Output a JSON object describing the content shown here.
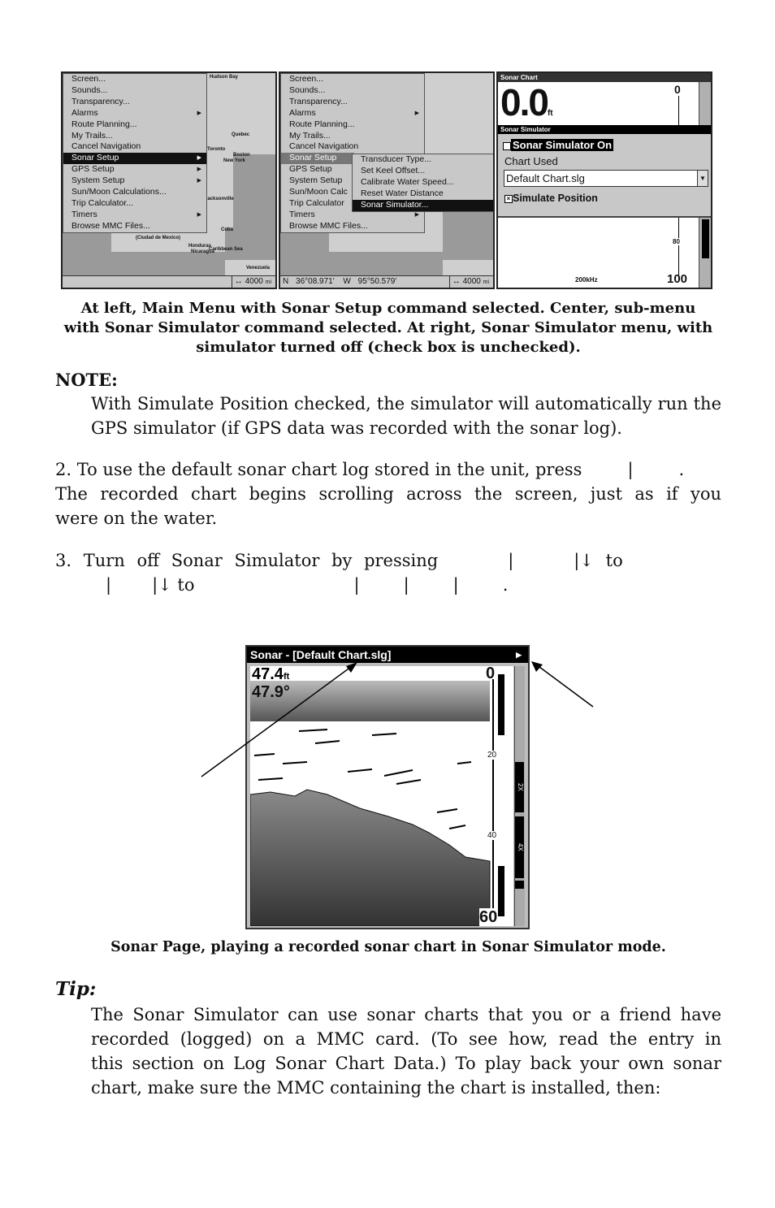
{
  "figure1": {
    "left_panel": {
      "menu_items": [
        {
          "label": "Screen...",
          "submenu": false
        },
        {
          "label": "Sounds...",
          "submenu": false
        },
        {
          "label": "Transparency...",
          "submenu": false
        },
        {
          "label": "Alarms",
          "submenu": true
        },
        {
          "label": "Route Planning...",
          "submenu": false
        },
        {
          "label": "My Trails...",
          "submenu": false
        },
        {
          "label": "Cancel Navigation",
          "submenu": false
        },
        {
          "label": "Sonar Setup",
          "submenu": true,
          "selected": true
        },
        {
          "label": "GPS Setup",
          "submenu": true
        },
        {
          "label": "System Setup",
          "submenu": true
        },
        {
          "label": "Sun/Moon Calculations...",
          "submenu": false
        },
        {
          "label": "Trip Calculator...",
          "submenu": false
        },
        {
          "label": "Timers",
          "submenu": true
        },
        {
          "label": "Browse MMC Files...",
          "submenu": false
        }
      ],
      "map_labels": [
        "Hudson Bay",
        "Quebec",
        "Toronto",
        "Boston",
        "New York",
        "Jacksonville",
        "Cuba",
        "Honduras",
        "Nicaragua",
        "Caribbean Sea",
        "Venezuela",
        "(Ciudad de Mexico)"
      ],
      "scale": "4000",
      "scale_unit": "mi"
    },
    "center_panel": {
      "menu_items": [
        "Screen...",
        "Sounds...",
        "Transparency...",
        "Alarms",
        "Route Planning...",
        "My Trails...",
        "Cancel Navigation",
        "Sonar Setup",
        "GPS Setup",
        "System Setup",
        "Sun/Moon Calc",
        "Trip Calculator",
        "Timers",
        "Browse MMC Files..."
      ],
      "submenu_items": [
        {
          "label": "Transducer Type..."
        },
        {
          "label": "Set Keel Offset..."
        },
        {
          "label": "Calibrate Water Speed..."
        },
        {
          "label": "Reset Water Distance"
        },
        {
          "label": "Sonar Simulator...",
          "selected": true
        }
      ],
      "lat_hemi": "N",
      "lat": "36°08.971'",
      "lon_hemi": "W",
      "lon": "95°50.579'",
      "scale": "4000",
      "scale_unit": "mi"
    },
    "right_panel": {
      "header": "Sonar Chart",
      "depth": "0.0",
      "depth_unit": "ft",
      "scale_top": "0",
      "dialog_title": "Sonar Simulator",
      "simulator_on_label": "Sonar Simulator On",
      "simulator_on_checked": false,
      "chart_used_label": "Chart Used",
      "chart_used_value": "Default Chart.slg",
      "simulate_position_label": "Simulate Position",
      "simulate_position_checked": true,
      "scale_mid": "80",
      "frequency": "200kHz",
      "scale_bottom": "100"
    },
    "caption": "At left, Main Menu with Sonar Setup command selected. Center, sub-menu with Sonar Simulator command selected. At right, Sonar Simulator menu, with simulator turned off (check box is unchecked)."
  },
  "note": {
    "heading": "NOTE:",
    "text": "With Simulate Position checked, the simulator will automatically run the GPS simulator (if GPS data was recorded with the sonar log)."
  },
  "step2": {
    "line1": "2. To use the default sonar chart log stored in the unit, press",
    "line1_sep": "|",
    "line1_end": ".",
    "line2": "The recorded chart begins scrolling across the screen, just as if you",
    "line3": "were on the water."
  },
  "step3": {
    "line1": "3. Turn off Sonar Simulator by pressing",
    "line1_sep1": "|",
    "line1_sep2": "|↓ to",
    "line2_sep1": "|",
    "line2_sep2": "|↓ to",
    "line2_seps": [
      "|",
      "|",
      "|"
    ],
    "line2_end": "."
  },
  "figure2": {
    "title": "Sonar - [Default Chart.slg]",
    "depth": "47.4",
    "depth_unit": "ft",
    "temperature": "47.9°",
    "scale_labels": [
      "0",
      "20",
      "40",
      "60"
    ],
    "zoom_labels": [
      "2X",
      "4X"
    ],
    "caption": "Sonar Page, playing a recorded sonar chart in Sonar Simulator mode."
  },
  "tip": {
    "heading": "Tip:",
    "lines": [
      "The Sonar Simulator can use sonar charts that you or a friend have",
      "recorded (logged) on a MMC card. (To see how, read the entry in",
      "this section on Log Sonar Chart Data.) To play back your own sonar",
      "chart, make sure the MMC containing the chart is installed, then:"
    ]
  }
}
